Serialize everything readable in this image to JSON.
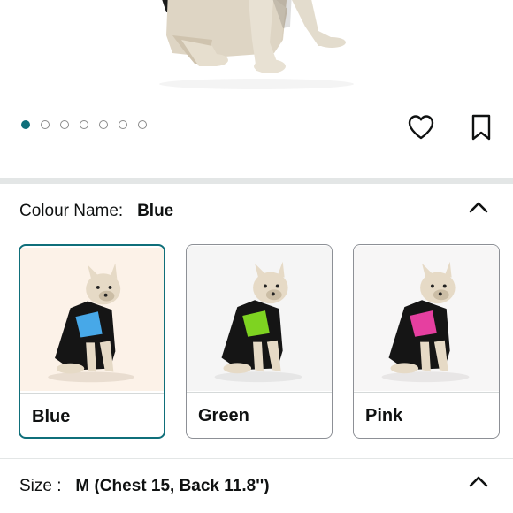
{
  "gallery": {
    "dots_total": 7,
    "dots_active_index": 0,
    "accent_color": "#0f6f7a"
  },
  "actions": {
    "heart_icon": "heart-outline-icon",
    "bookmark_icon": "bookmark-outline-icon"
  },
  "colour": {
    "label": "Colour Name:",
    "value": "Blue",
    "options": [
      {
        "label": "Blue",
        "vest_color": "#47a8e8",
        "bg": "#fcf2e8"
      },
      {
        "label": "Green",
        "vest_color": "#7ed321",
        "bg": "#f5f5f5"
      },
      {
        "label": "Pink",
        "vest_color": "#e63fa0",
        "bg": "#f7f6f6"
      }
    ],
    "selected_index": 0
  },
  "size": {
    "label": "Size :",
    "value": "M (Chest 15, Back 11.8'')"
  }
}
